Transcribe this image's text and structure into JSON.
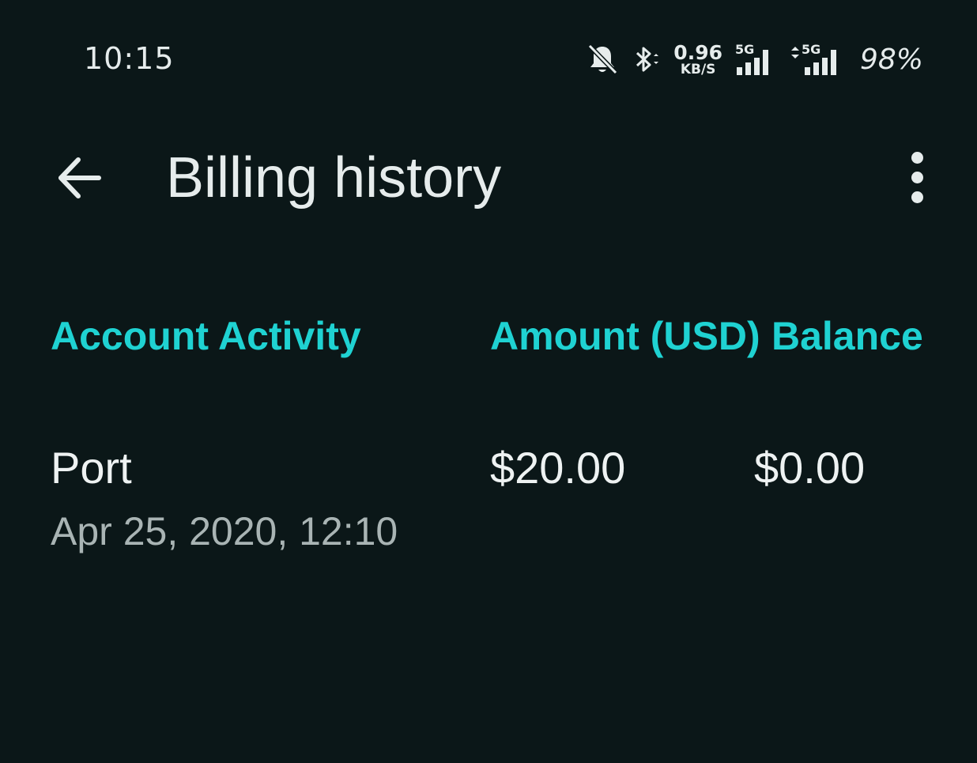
{
  "status_bar": {
    "time": "10:15",
    "icons": [
      "bell-off-icon",
      "bluetooth-icon",
      "signal-5g-icon",
      "signal-5g-icon"
    ],
    "net_speed_value": "0.96",
    "net_speed_unit": "KB/S",
    "signal_1_label": "5G",
    "signal_2_label": "5G",
    "battery": "98%"
  },
  "app_bar": {
    "title": "Billing history",
    "back_icon": "arrow-left-icon",
    "menu_icon": "more-vert-icon"
  },
  "table": {
    "headers": {
      "activity": "Account Activity",
      "amount": "Amount (USD)",
      "balance": "Balance"
    },
    "rows": [
      {
        "activity": "Port",
        "date": "Apr 25, 2020, 12:10",
        "amount": "$20.00",
        "balance": "$0.00"
      }
    ]
  },
  "colors": {
    "background": "#0b1718",
    "accent": "#1fd2d2",
    "text_primary": "#eef2f2",
    "text_secondary": "#a9b4b4"
  }
}
